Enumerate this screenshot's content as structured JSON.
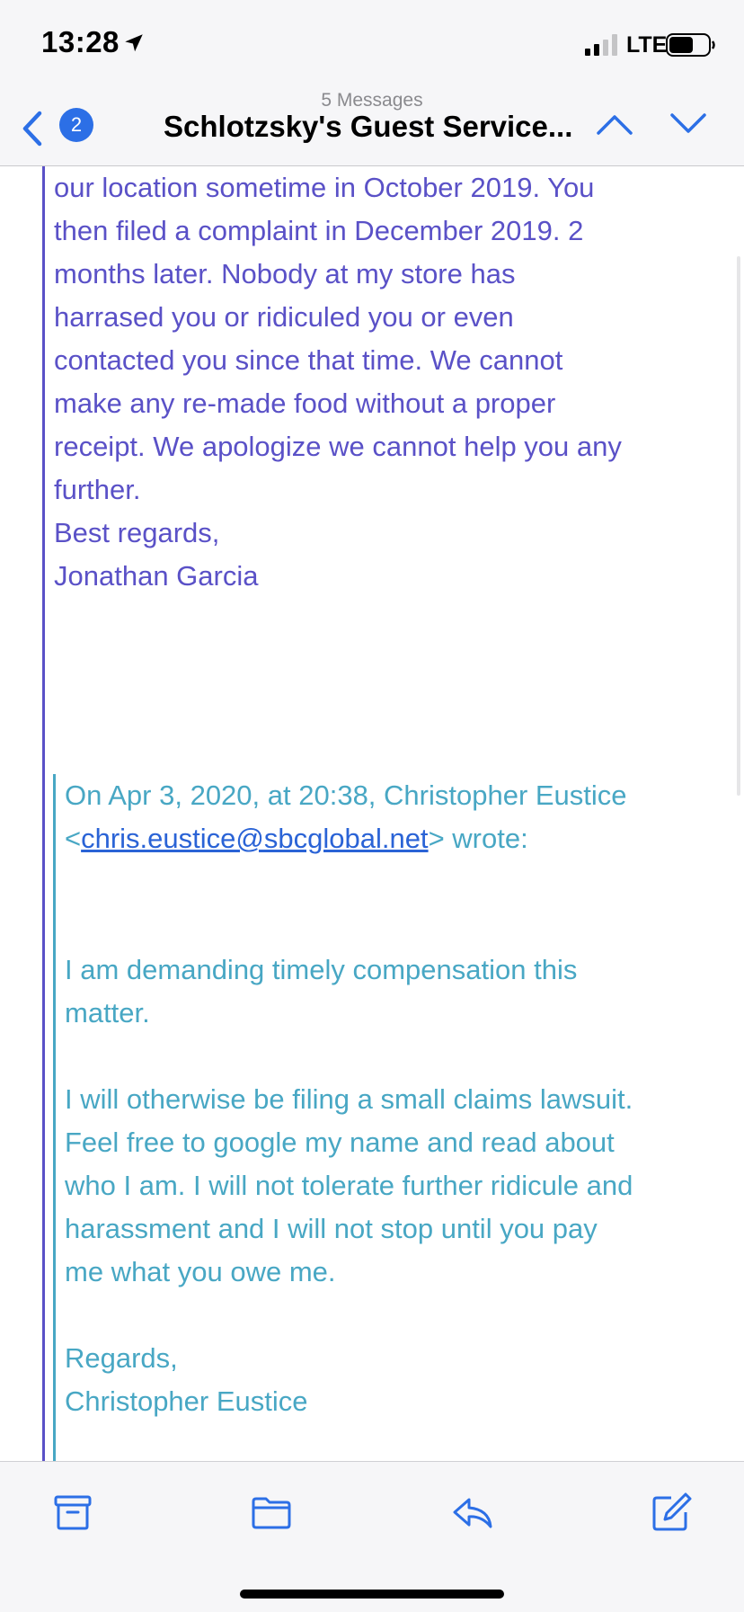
{
  "status_bar": {
    "time": "13:28",
    "network": "LTE"
  },
  "nav": {
    "unread_count": "2",
    "message_count_label": "5 Messages",
    "title": "Schlotzsky's Guest Service..."
  },
  "email": {
    "reply_lines": [
      "our location sometime in October 2019.  You",
      "then filed a complaint in December 2019. 2",
      "months later.  Nobody at my store has",
      "harrased you or ridiculed you or even",
      "contacted you since that time. We cannot",
      "make any re-made food without a proper",
      "receipt. We apologize we cannot help you any",
      "further."
    ],
    "reply_closing": "Best regards,",
    "reply_signature": "Jonathan Garcia",
    "quote_attribution_prefix": "On Apr 3, 2020, at 20:38, Christopher Eustice",
    "quote_email": "chris.eustice@sbcglobal.net",
    "quote_attribution_suffix": "> wrote:",
    "quote_para1": [
      "I am demanding timely compensation this",
      "matter."
    ],
    "quote_para2": [
      "I will otherwise be filing a small claims lawsuit.",
      "Feel free to google my name and read about",
      "who I am. I will not tolerate further ridicule and",
      "harassment and I will not stop until you pay",
      "me what you owe me."
    ],
    "quote_closing": "Regards,",
    "quote_signature": "Christopher Eustice"
  },
  "toolbar": {
    "icons": [
      "archive-icon",
      "folder-icon",
      "reply-icon",
      "compose-icon"
    ]
  },
  "colors": {
    "accent": "#2c6fe6",
    "reply_text": "#5a51c7",
    "quoted_text": "#48a7c4",
    "bar_background": "#f6f6f8"
  }
}
